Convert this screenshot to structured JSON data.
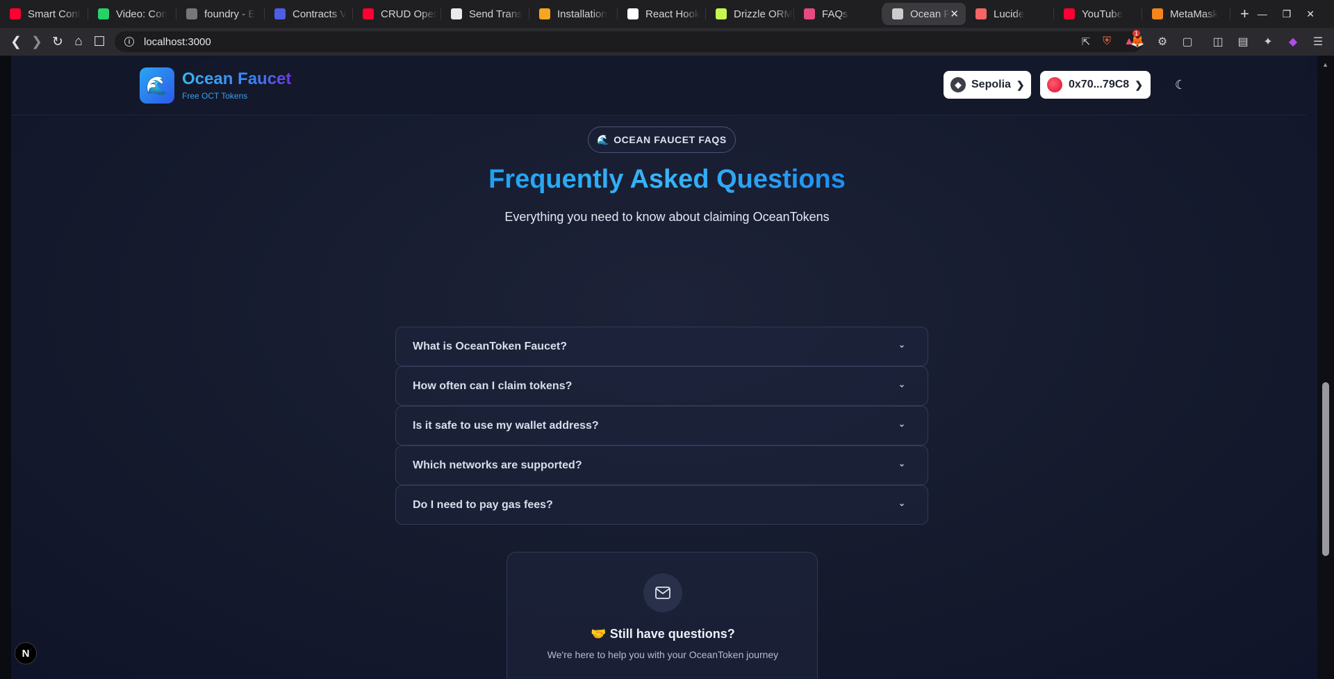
{
  "browser": {
    "tabs": [
      {
        "title": "Smart Cont",
        "favicon": "youtube-icon",
        "color": "#ff0033"
      },
      {
        "title": "Video: Con",
        "favicon": "whatsapp-icon",
        "color": "#25d366"
      },
      {
        "title": "foundry - E",
        "favicon": "foundry-icon",
        "color": "#777777"
      },
      {
        "title": "Contracts V",
        "favicon": "zeppelin-icon",
        "color": "#4e5ee4"
      },
      {
        "title": "CRUD Oper",
        "favicon": "youtube-icon",
        "color": "#ff0033"
      },
      {
        "title": "Send Trans",
        "favicon": "wagmi-icon",
        "color": "#eaeaea"
      },
      {
        "title": "Installation",
        "favicon": "rainbow-icon",
        "color": "#f5a623"
      },
      {
        "title": "React Hook",
        "favicon": "react-hook-form-icon",
        "color": "#ffffff"
      },
      {
        "title": "Drizzle ORM",
        "favicon": "drizzle-icon",
        "color": "#c5f74f"
      },
      {
        "title": "FAQs",
        "favicon": "gear-icon",
        "color": "#e84a7f"
      },
      {
        "title": "Ocean F",
        "favicon": "globe-icon",
        "color": "#cccccc",
        "active": true
      },
      {
        "title": "Lucide",
        "favicon": "lucide-icon",
        "color": "#f56565"
      },
      {
        "title": "YouTube",
        "favicon": "youtube-icon",
        "color": "#ff0033"
      },
      {
        "title": "MetaMask",
        "favicon": "metamask-icon",
        "color": "#f6851b"
      }
    ],
    "url": "localhost:3000",
    "brave_badge_count": "1"
  },
  "header": {
    "brand_title": "Ocean Faucet",
    "brand_subtitle": "Free OCT Tokens",
    "brand_icon": "wave-icon",
    "network_label": "Sepolia",
    "account_label": "0x70...79C8"
  },
  "faq": {
    "badge": "OCEAN FAUCET FAQS",
    "badge_emoji": "🌊",
    "title": "Frequently Asked Questions",
    "subtitle": "Everything you need to know about claiming OceanTokens",
    "items": [
      {
        "question": "What is OceanToken Faucet?"
      },
      {
        "question": "How often can I claim tokens?"
      },
      {
        "question": "Is it safe to use my wallet address?"
      },
      {
        "question": "Which networks are supported?"
      },
      {
        "question": "Do I need to pay gas fees?"
      }
    ]
  },
  "help": {
    "emoji": "🤝",
    "title": "Still have questions?",
    "subtitle": "We're here to help you with your OceanToken journey"
  },
  "dev": {
    "next_indicator": "N"
  },
  "colors": {
    "accent": "#1fa2f3",
    "brand_gradient_end": "#6a39e6",
    "background": "#151a2d"
  }
}
